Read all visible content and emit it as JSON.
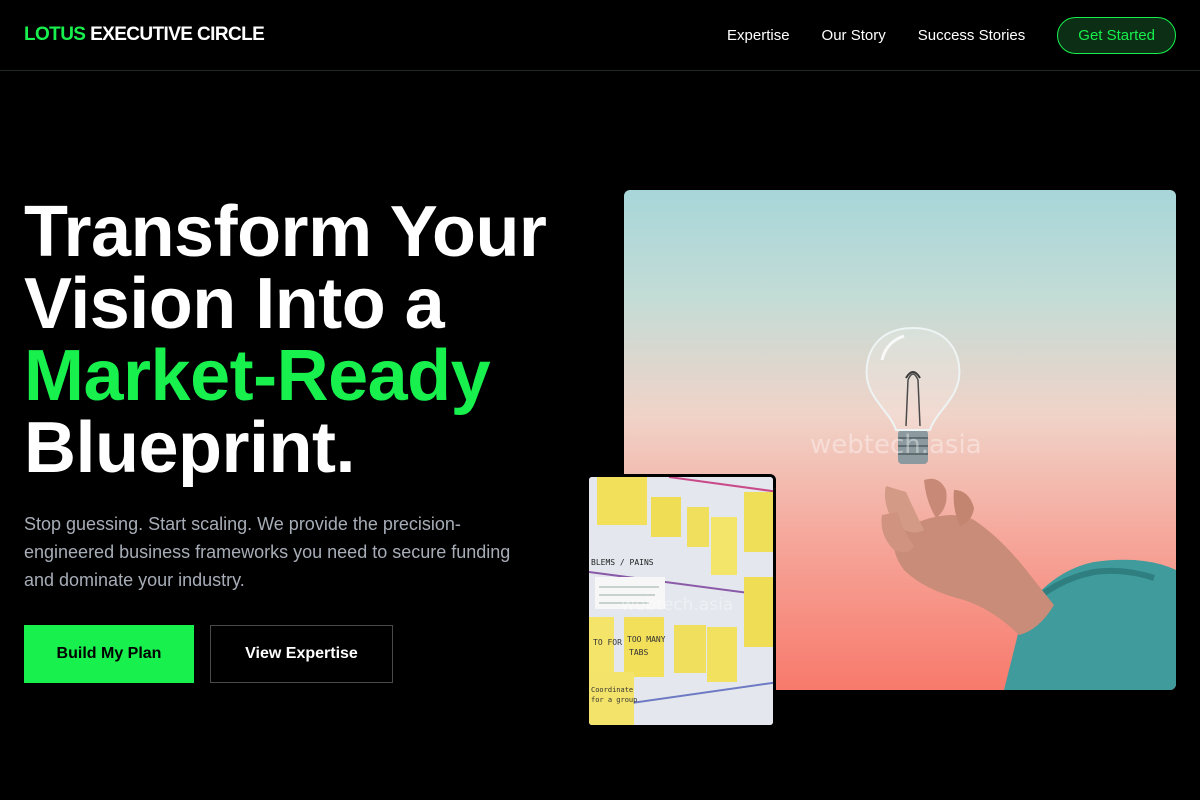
{
  "brand": {
    "accent": "LOTUS",
    "rest": "EXECUTIVE CIRCLE"
  },
  "nav": {
    "links": [
      "Expertise",
      "Our Story",
      "Success Stories"
    ],
    "cta": "Get Started"
  },
  "hero": {
    "headline": {
      "line1": "Transform Your",
      "line2": "Vision Into a",
      "highlight": "Market-Ready",
      "line4": "Blueprint."
    },
    "subtext": "Stop guessing. Start scaling. We provide the precision-engineered business frameworks you need to secure funding and dominate your industry.",
    "primary_button": "Build My Plan",
    "secondary_button": "View Expertise"
  },
  "images": {
    "main_watermark": "webtech.asia",
    "overlay_watermark": "webtech.asia",
    "overlay_note_text": [
      "TOO MANY TABS",
      "BLEMS / PAINS",
      "TO FOR",
      "Coordinate for a group"
    ]
  },
  "colors": {
    "accent": "#17f04d",
    "background": "#000000",
    "muted_text": "#a7adb7"
  },
  "icons": [
    "lightbulb-photo",
    "sticky-notes-photo"
  ]
}
